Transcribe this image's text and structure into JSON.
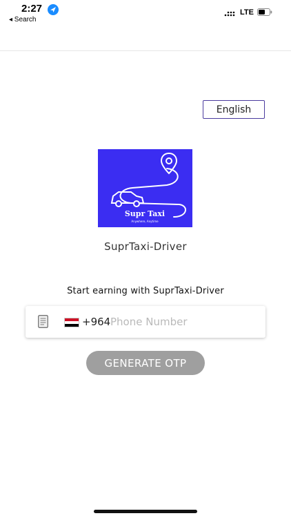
{
  "status_bar": {
    "time": "2:27",
    "back_label": "◂ Search",
    "network": "LTE"
  },
  "language_button": {
    "label": "English"
  },
  "logo": {
    "title": "Supr Taxi",
    "subtitle": "Anywhere, Anytime"
  },
  "app_name": "SuprTaxi-Driver",
  "tagline": "Start earning with SuprTaxi-Driver",
  "phone_field": {
    "country_code": "+964",
    "placeholder": "Phone Number",
    "value": ""
  },
  "otp_button": {
    "label": "GENERATE OTP"
  },
  "colors": {
    "logo_bg": "#3b2df2",
    "language_border": "#4a3a9e",
    "button_disabled": "#9f9f9f"
  }
}
